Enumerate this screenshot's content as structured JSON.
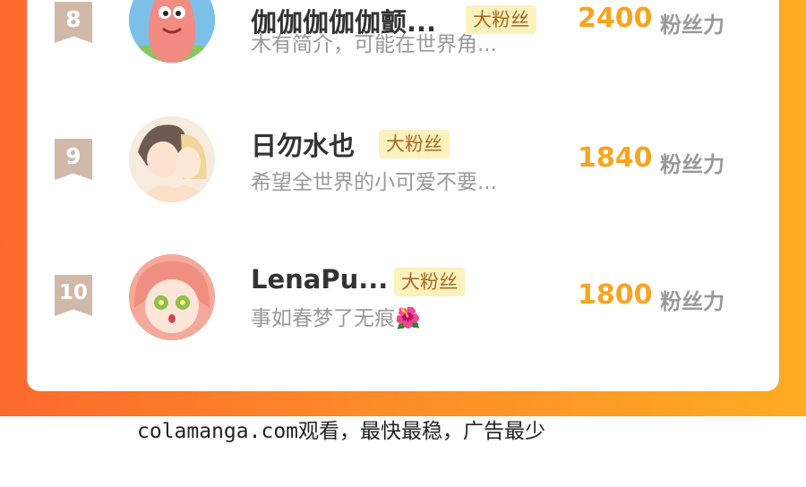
{
  "fans": [
    {
      "rank": "8",
      "name": "伽伽伽伽伽颤...",
      "badge": "大粉丝",
      "bio": "木有简介，可能在世界角...",
      "count": "2400",
      "unit": "粉丝力"
    },
    {
      "rank": "9",
      "name": "日勿水也",
      "badge": "大粉丝",
      "bio": "希望全世界的小可爱不要...",
      "count": "1840",
      "unit": "粉丝力"
    },
    {
      "rank": "10",
      "name": "LenaPu...",
      "badge": "大粉丝",
      "bio": "事如春梦了无痕",
      "emoji": "🌺",
      "count": "1800",
      "unit": "粉丝力"
    }
  ],
  "footer": "colamanga.com观看，最快最稳，广告最少"
}
